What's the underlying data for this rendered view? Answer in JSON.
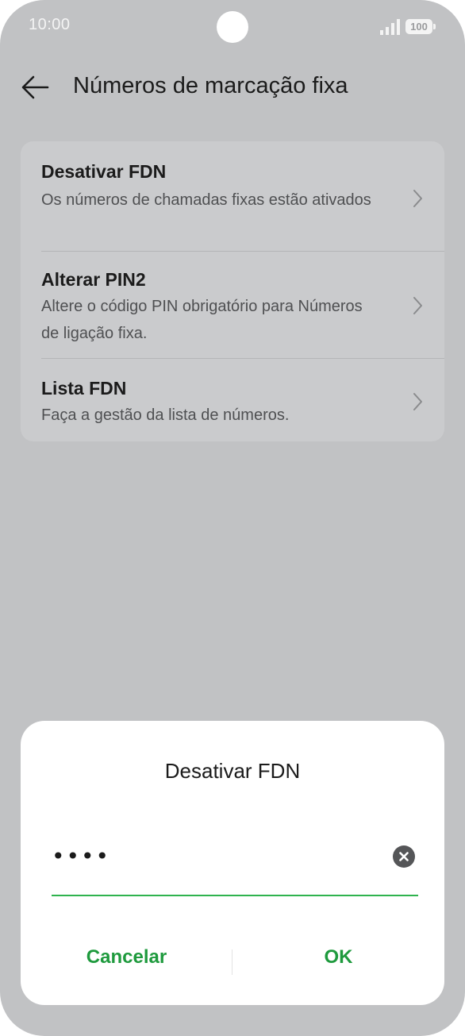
{
  "status_bar": {
    "time": "10:00",
    "battery": "100",
    "signal_icon": "signal-bars-icon",
    "camera_icon": "front-camera-icon"
  },
  "header": {
    "back_icon": "back-arrow-icon",
    "title": "Números de marcação fixa"
  },
  "settings": {
    "items": [
      {
        "title": "Desativar FDN",
        "subtitle": "Os números de chamadas fixas estão ativados"
      },
      {
        "title": "Alterar PIN2",
        "subtitle": "Altere o código PIN obrigatório para Números de ligação fixa."
      },
      {
        "title": "Lista FDN",
        "subtitle": "Faça a gestão da lista de números."
      }
    ]
  },
  "dialog": {
    "title": "Desativar FDN",
    "pin_value": "••••",
    "clear_icon": "clear-x-circle-icon",
    "cancel_label": "Cancelar",
    "ok_label": "OK"
  },
  "colors": {
    "background": "#c1c2c4",
    "card": "#cacbcd",
    "accent": "#1e9a3d",
    "underline": "#2fb34e"
  }
}
